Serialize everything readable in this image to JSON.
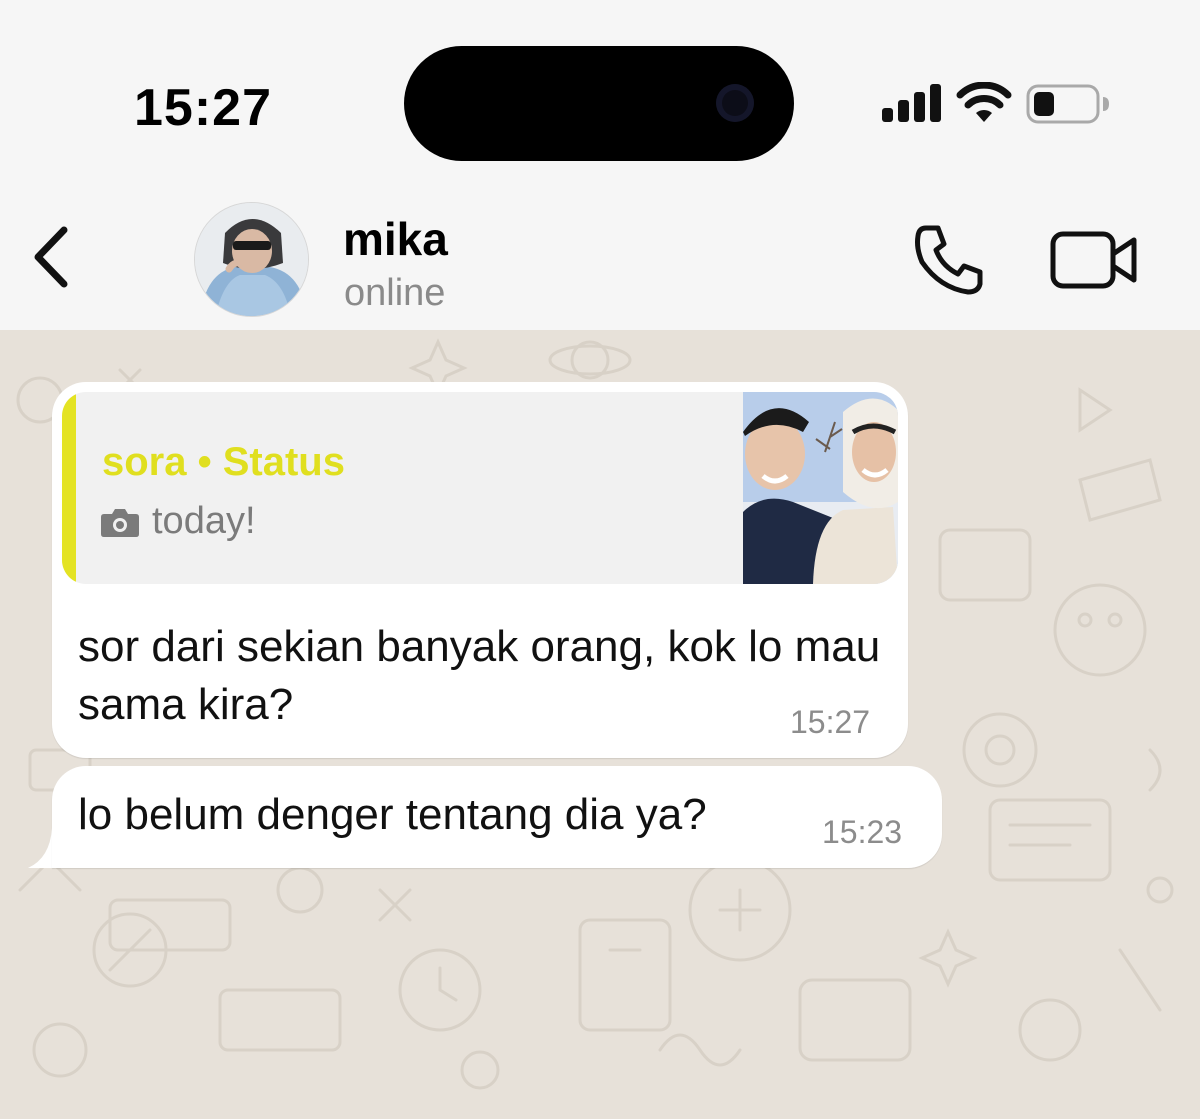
{
  "status_bar": {
    "time": "15:27",
    "icons": [
      "signal-icon",
      "wifi-icon",
      "battery-icon"
    ],
    "battery_level": 0.35
  },
  "header": {
    "contact_name": "mika",
    "contact_status": "online",
    "icons": [
      "back-chevron-icon",
      "phone-icon",
      "video-camera-icon"
    ]
  },
  "messages": [
    {
      "direction": "outgoing",
      "quote": {
        "author": "sora • Status",
        "icon": "camera-icon",
        "caption": "today!"
      },
      "text": "sor dari sekian banyak orang, kok lo mau sama kira?",
      "time": "15:27"
    },
    {
      "direction": "incoming",
      "text": "lo belum denger tentang dia ya?",
      "time": "15:23"
    }
  ],
  "colors": {
    "chat_background": "#e7e1d9",
    "bubble": "#ffffff",
    "status_accent": "#e4e323",
    "secondary_text": "#8a8a8a"
  }
}
